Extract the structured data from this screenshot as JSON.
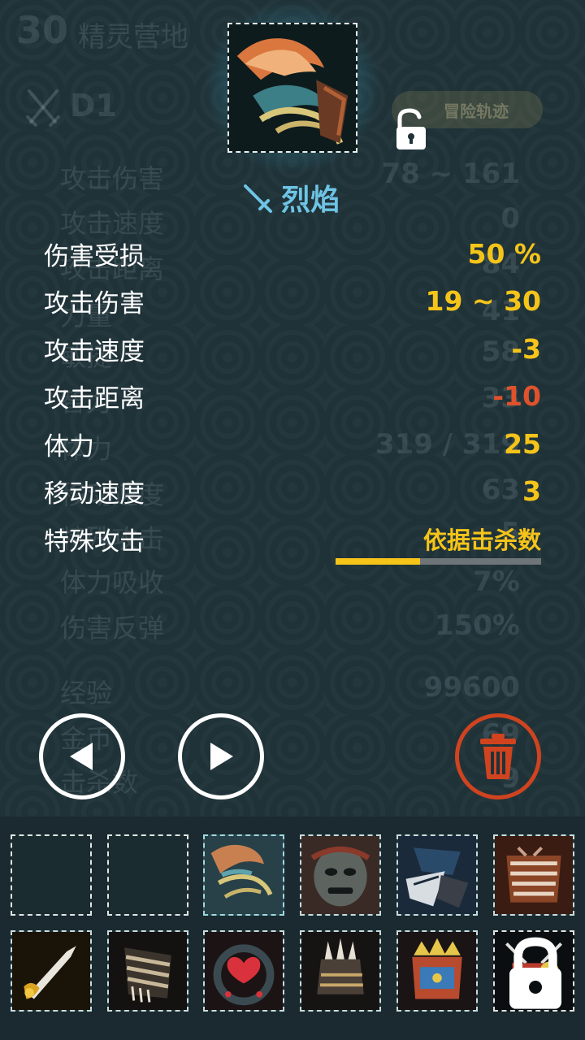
{
  "background_page": {
    "level": "30",
    "title": "精灵营地",
    "rank": "D1",
    "badge_label": "冒险轨迹",
    "stats": [
      {
        "label": "攻击伤害",
        "value": "78 ~ 161"
      },
      {
        "label": "攻击速度",
        "value": "0"
      },
      {
        "label": "攻击距离",
        "value": "84"
      },
      {
        "label": "力量",
        "value": "41"
      },
      {
        "label": "敏捷",
        "value": "58"
      },
      {
        "label": "智力",
        "value": "33"
      },
      {
        "label": "体力",
        "value": "319 / 319"
      },
      {
        "label": "移动速度",
        "value": "63"
      },
      {
        "label": "特殊攻击",
        "value": "5"
      },
      {
        "label": "体力吸收",
        "value": "7%"
      },
      {
        "label": "伤害反弹",
        "value": "150%"
      },
      {
        "label": "经验",
        "value": "99600"
      },
      {
        "label": "金币",
        "value": "69"
      },
      {
        "label": "击杀数",
        "value": "9"
      }
    ]
  },
  "item": {
    "name": "烈焰",
    "type_icon": "sword-icon",
    "lock_icon": "unlocked-padlock-icon",
    "stats": [
      {
        "label": "伤害受损",
        "value": "50 %",
        "color": "#f5c419"
      },
      {
        "label": "攻击伤害",
        "value": "19 ~ 30",
        "color": "#f5c419"
      },
      {
        "label": "攻击速度",
        "value": "-3",
        "color": "#f5c419"
      },
      {
        "label": "攻击距离",
        "value": "-10",
        "color": "#e0522c"
      },
      {
        "label": "体力",
        "value": "25",
        "color": "#f5c419"
      },
      {
        "label": "移动速度",
        "value": "3",
        "color": "#f5c419"
      },
      {
        "label": "特殊攻击",
        "value": "依据击杀数",
        "color": "#f5c419"
      }
    ],
    "special_progress": 0.41
  },
  "buttons": {
    "prev_icon": "triangle-left-icon",
    "next_icon": "triangle-right-icon",
    "delete_icon": "trash-icon",
    "delete_color": "#d0431f"
  },
  "inventory": {
    "slots": [
      {
        "state": "empty"
      },
      {
        "state": "empty"
      },
      {
        "state": "item",
        "icon": "flame-claw-icon",
        "selected": true
      },
      {
        "state": "item",
        "icon": "stone-mask-icon"
      },
      {
        "state": "item",
        "icon": "dark-wing-blade-icon"
      },
      {
        "state": "item",
        "icon": "rusted-armor-icon"
      },
      {
        "state": "item",
        "icon": "golden-dagger-icon"
      },
      {
        "state": "item",
        "icon": "banded-gauntlet-icon"
      },
      {
        "state": "item",
        "icon": "heart-amulet-icon"
      },
      {
        "state": "item",
        "icon": "spiked-gauntlet-icon"
      },
      {
        "state": "item",
        "icon": "crowned-armor-icon"
      },
      {
        "state": "item",
        "icon": "jeweled-armor-icon",
        "locked": true
      }
    ]
  }
}
